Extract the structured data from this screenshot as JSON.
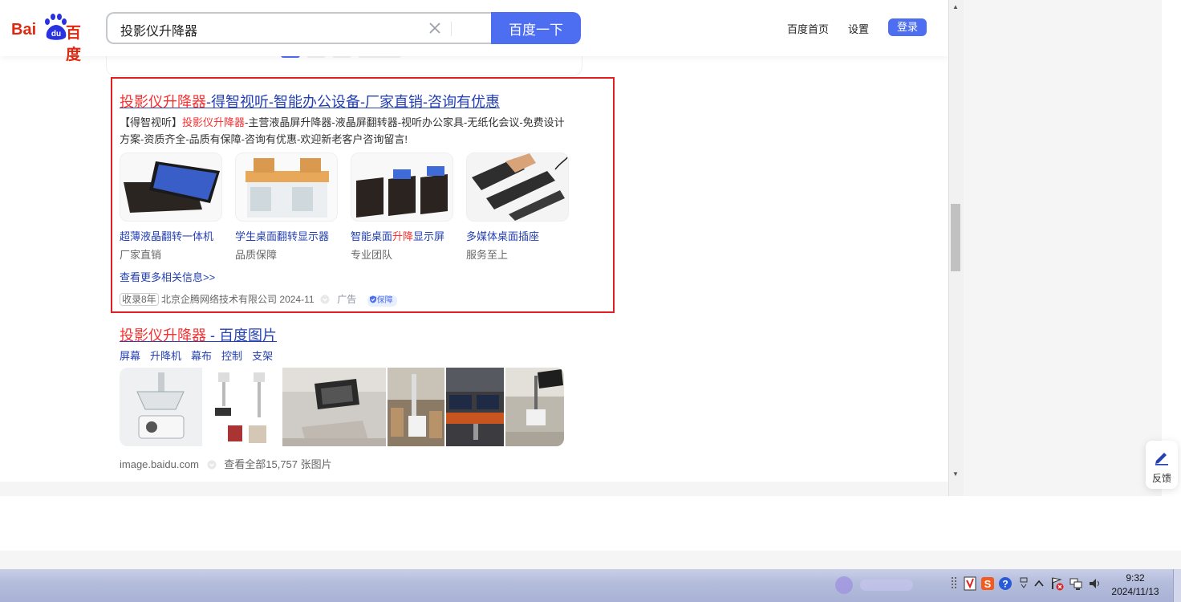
{
  "header": {
    "logo_left": "Bai",
    "logo_du": "du",
    "logo_right": "百度",
    "search_value": "投影仪升降器",
    "search_button": "百度一下",
    "nav_home": "百度首页",
    "nav_settings": "设置",
    "login": "登录"
  },
  "ad_result": {
    "title_hl": "投影仪升降器",
    "title_rest": "-得智视听-智能办公设备-厂家直销-咨询有优惠",
    "desc_prefix": "【得智视听】",
    "desc_hl": "投影仪升降器",
    "desc_rest": "-主营液晶屏升降器-液晶屏翻转器-视听办公家具-无纸化会议-免费设计方案-资质齐全-品质有保障-咨询有优惠-欢迎新老客户咨询留言!",
    "products": [
      {
        "name": "超薄液晶翻转一体机",
        "sub": "厂家直销"
      },
      {
        "name": "学生桌面翻转显示器",
        "sub": "品质保障"
      },
      {
        "name_pre": "智能桌面",
        "name_hl": "升降",
        "name_post": "显示屏",
        "sub": "专业团队"
      },
      {
        "name": "多媒体桌面插座",
        "sub": "服务至上"
      }
    ],
    "more": "查看更多相关信息>>",
    "badge": "收录8年",
    "company": "北京企腾网络技术有限公司",
    "date": "2024-11",
    "ad_label": "广告",
    "guarantee": "保障"
  },
  "image_result": {
    "title_hl": "投影仪升降器",
    "title_rest": " - 百度图片",
    "tags": [
      "屏幕",
      "升降机",
      "幕布",
      "控制",
      "支架"
    ],
    "source": "image.baidu.com",
    "view_all": "查看全部15,757 张图片"
  },
  "feedback": "反馈",
  "taskbar": {
    "time": "9:32",
    "date": "2024/11/13"
  }
}
